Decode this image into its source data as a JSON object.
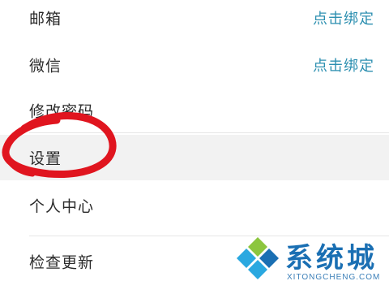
{
  "settings_list": {
    "items": [
      {
        "label": "邮箱",
        "action": "点击绑定"
      },
      {
        "label": "微信",
        "action": "点击绑定"
      },
      {
        "label": "修改密码"
      },
      {
        "label": "设置"
      },
      {
        "label": "个人中心"
      },
      {
        "label": "检查更新"
      }
    ]
  },
  "annotation": {
    "color": "#e0151f"
  },
  "watermark": {
    "title": "系统城",
    "subtitle": "XITONGCHENG.COM",
    "colors": [
      "#1a6fb3",
      "#2aa8e0",
      "#8cc63f"
    ]
  }
}
